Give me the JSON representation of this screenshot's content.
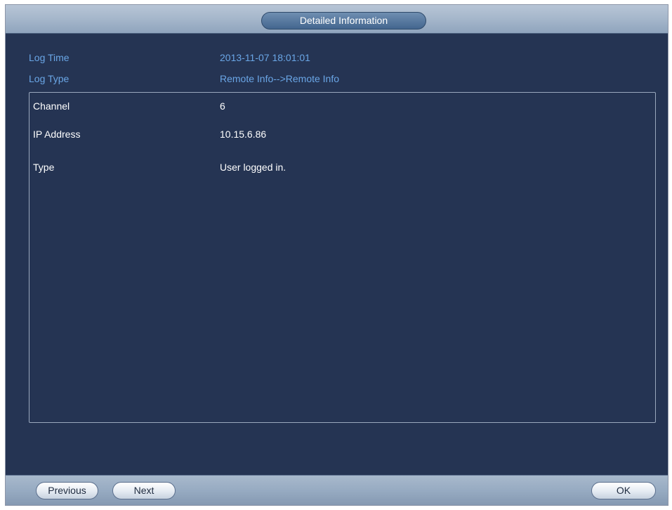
{
  "dialog": {
    "title": "Detailed Information",
    "fields": [
      {
        "label": "Log Time",
        "value": "2013-11-07 18:01:01"
      },
      {
        "label": "Log Type",
        "value": "Remote Info-->Remote Info"
      }
    ],
    "details": [
      {
        "label": "Channel",
        "value": "6"
      },
      {
        "label": "IP Address",
        "value": "10.15.6.86"
      },
      {
        "label": "Type",
        "value": "User logged in."
      }
    ]
  },
  "buttons": {
    "previous": "Previous",
    "next": "Next",
    "ok": "OK"
  },
  "colors": {
    "panel_background": "#253453",
    "field_text": "#6aa6e6",
    "detail_text": "#ffffff"
  }
}
